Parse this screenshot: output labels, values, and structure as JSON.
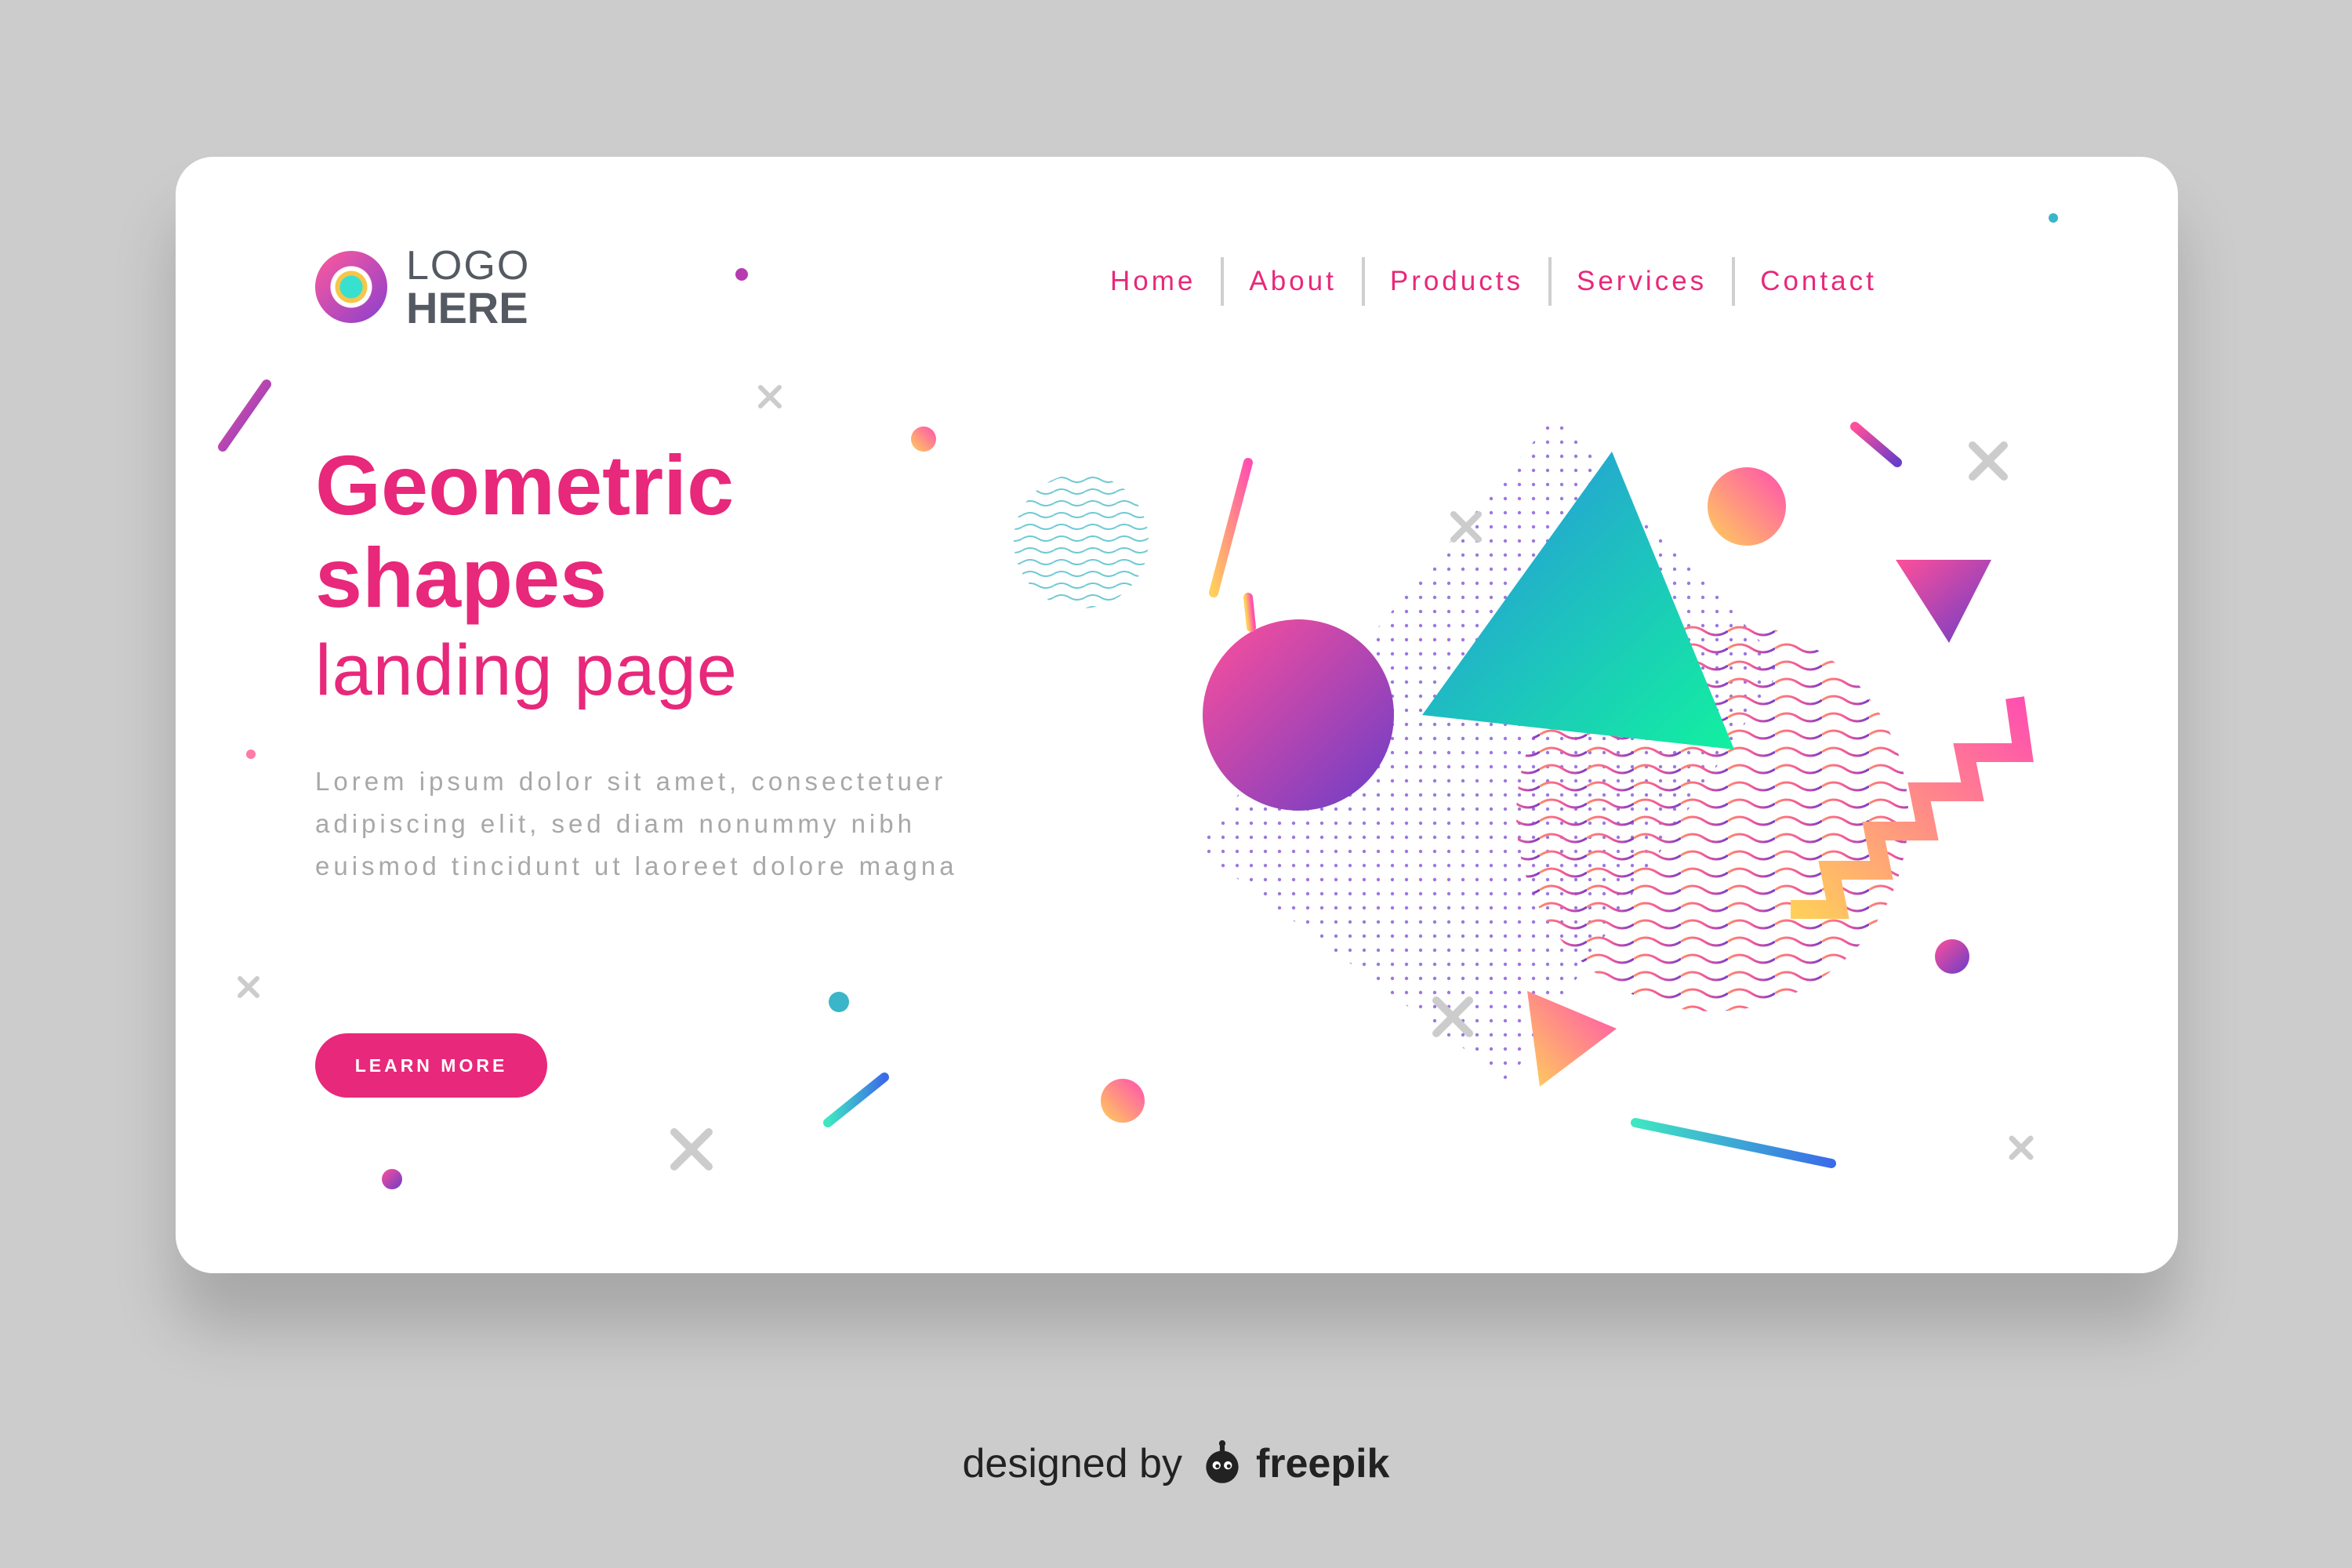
{
  "logo": {
    "top": "LOGO",
    "bottom": "HERE"
  },
  "nav": {
    "items": [
      {
        "label": "Home"
      },
      {
        "label": "About"
      },
      {
        "label": "Products"
      },
      {
        "label": "Services"
      },
      {
        "label": "Contact"
      }
    ]
  },
  "hero": {
    "line1": "Geometric",
    "line2": "shapes",
    "line3": "landing page",
    "body": "Lorem ipsum dolor sit amet, consectetuer adipiscing elit, sed diam nonummy nibh euismod tincidunt ut laoreet dolore magna",
    "cta": "LEARN MORE"
  },
  "credit": {
    "prefix": "designed by",
    "brand": "freepik"
  },
  "colors": {
    "accent": "#e8287a",
    "background": "#cccccc",
    "card": "#ffffff",
    "muted": "#a8a8a8"
  }
}
